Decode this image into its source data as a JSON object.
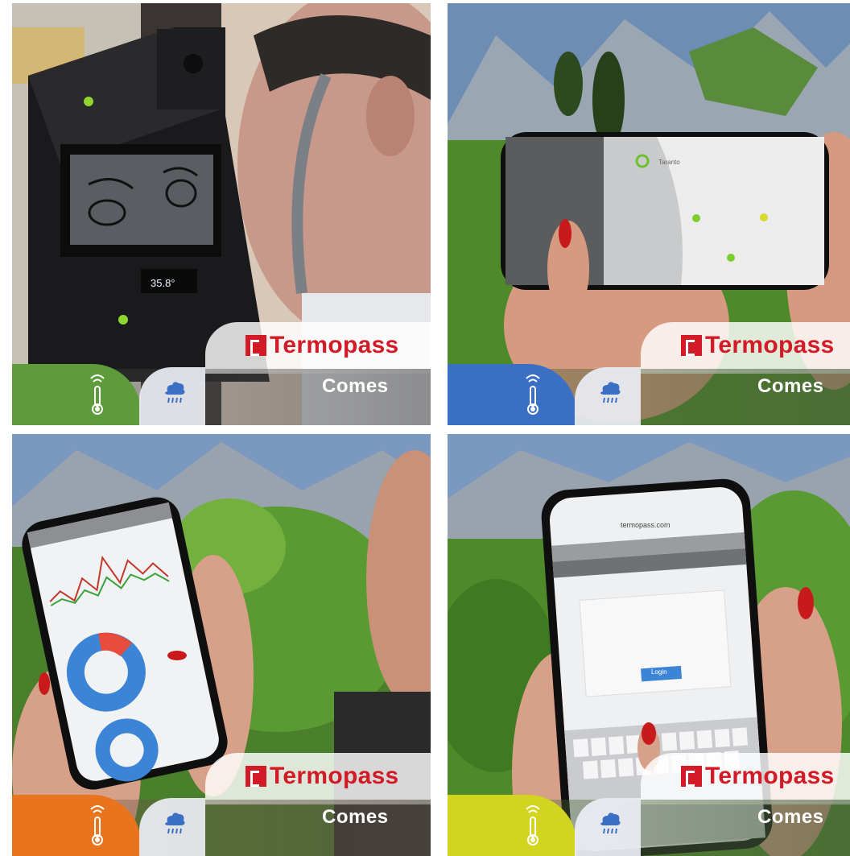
{
  "panels": [
    {
      "id": "p1",
      "accent": "#5e9b3a",
      "brand": "Termopass",
      "company": "Comes",
      "display_reading": "35.8°",
      "scene": "device"
    },
    {
      "id": "p2",
      "accent": "#3b6fc4",
      "brand": "Termopass",
      "company": "Comes",
      "map_label": "Taranto",
      "scene": "phone-landscape-map"
    },
    {
      "id": "p3",
      "accent": "#e8741d",
      "brand": "Termopass",
      "company": "Comes",
      "scene": "phone-portrait-dashboard"
    },
    {
      "id": "p4",
      "accent": "#d2d41f",
      "brand": "Termopass",
      "company": "Comes",
      "url": "termopass.com",
      "login_button": "Login",
      "scene": "phone-portrait-login"
    }
  ],
  "icons": [
    "thermometer-wifi-icon",
    "cloud-sprinkle-icon",
    "termopass-logo-icon"
  ]
}
